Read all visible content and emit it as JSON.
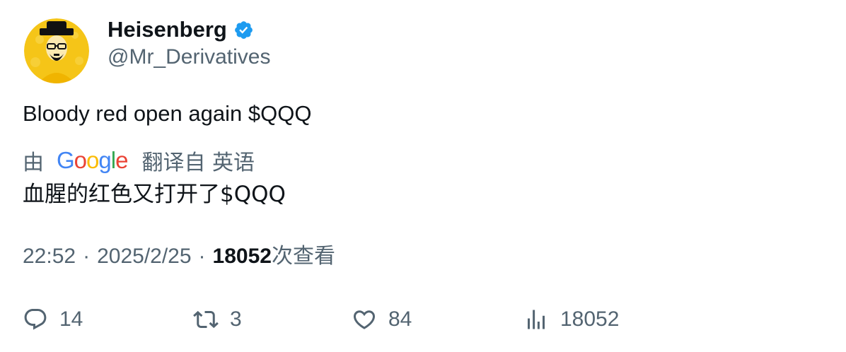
{
  "tweet": {
    "author": {
      "display_name": "Heisenberg",
      "handle": "@Mr_Derivatives",
      "verified": true,
      "avatar_icon": "heisenberg-avatar"
    },
    "text": "Bloody red open again $QQQ",
    "translation": {
      "by_label": "由",
      "provider": "Google",
      "from_label": "翻译自 英语",
      "text": "血腥的红色又打开了$QQQ"
    },
    "meta": {
      "time": "22:52",
      "separator": "·",
      "date": "2025/2/25",
      "views_count": "18052",
      "views_label": "次查看"
    },
    "actions": {
      "replies": "14",
      "retweets": "3",
      "likes": "84",
      "views": "18052"
    }
  },
  "colors": {
    "text_primary": "#0f1419",
    "text_secondary": "#536471",
    "verified_blue": "#1d9bf0",
    "google_blue": "#4285F4",
    "google_red": "#EA4335",
    "google_yellow": "#FBBC05",
    "google_green": "#34A853",
    "avatar_yellow": "#f5c518"
  }
}
